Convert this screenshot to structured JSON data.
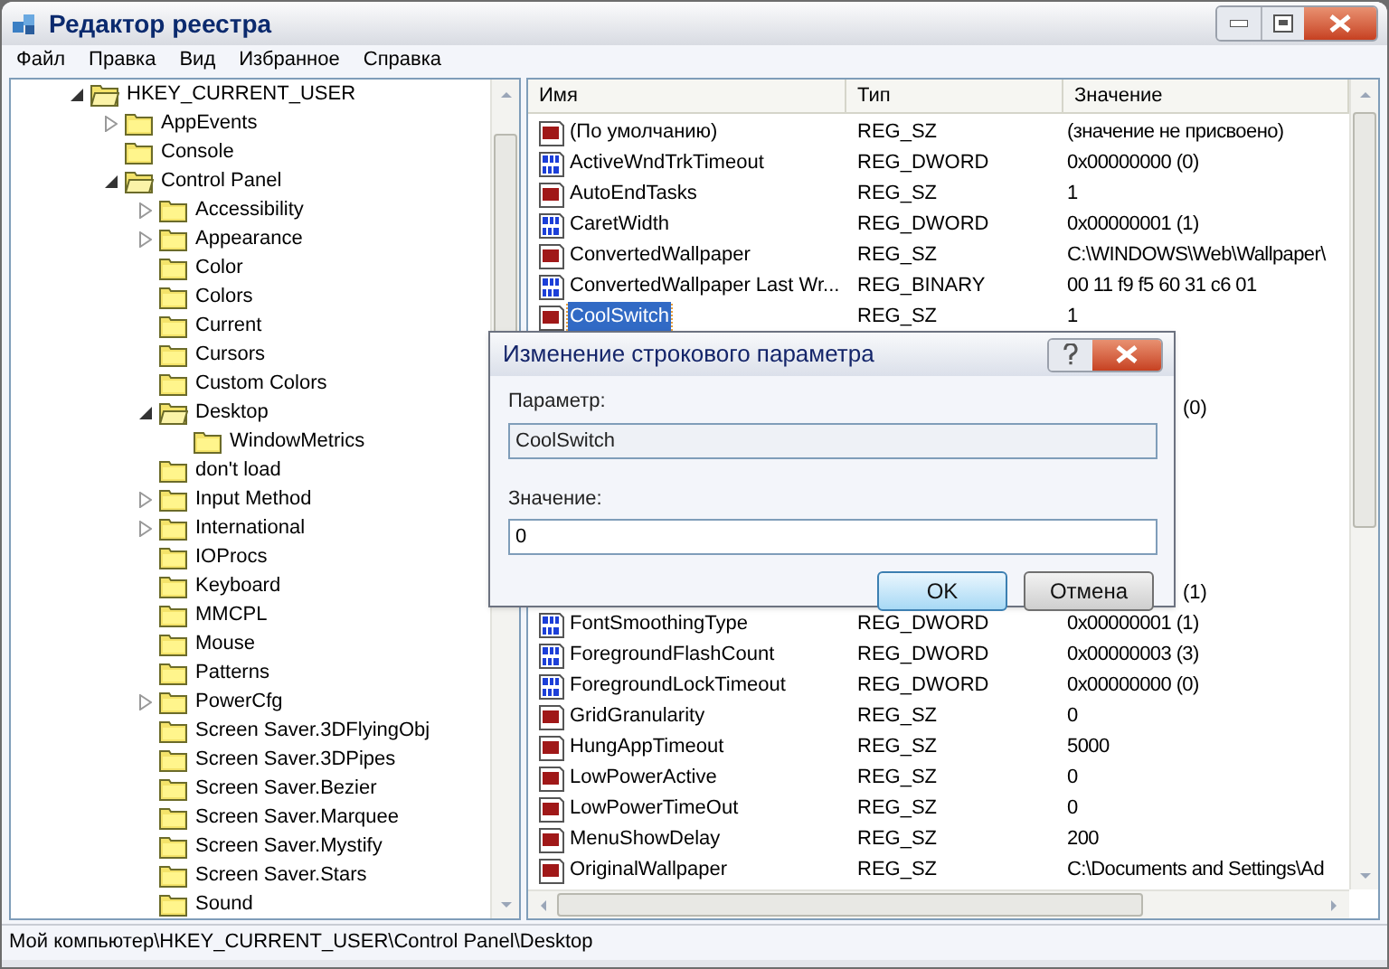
{
  "window": {
    "title": "Редактор реестра"
  },
  "menu": [
    "Файл",
    "Правка",
    "Вид",
    "Избранное",
    "Справка"
  ],
  "tree": [
    {
      "label": "HKEY_CURRENT_USER",
      "expanded": true,
      "children": [
        {
          "label": "AppEvents",
          "expanded": false
        },
        {
          "label": "Console"
        },
        {
          "label": "Control Panel",
          "expanded": true,
          "children": [
            {
              "label": "Accessibility",
              "expanded": false
            },
            {
              "label": "Appearance",
              "expanded": false
            },
            {
              "label": "Color"
            },
            {
              "label": "Colors"
            },
            {
              "label": "Current"
            },
            {
              "label": "Cursors"
            },
            {
              "label": "Custom Colors"
            },
            {
              "label": "Desktop",
              "expanded": true,
              "children": [
                {
                  "label": "WindowMetrics"
                }
              ]
            },
            {
              "label": "don't load"
            },
            {
              "label": "Input Method",
              "expanded": false
            },
            {
              "label": "International",
              "expanded": false
            },
            {
              "label": "IOProcs"
            },
            {
              "label": "Keyboard"
            },
            {
              "label": "MMCPL"
            },
            {
              "label": "Mouse"
            },
            {
              "label": "Patterns"
            },
            {
              "label": "PowerCfg",
              "expanded": false
            },
            {
              "label": "Screen Saver.3DFlyingObj"
            },
            {
              "label": "Screen Saver.3DPipes"
            },
            {
              "label": "Screen Saver.Bezier"
            },
            {
              "label": "Screen Saver.Marquee"
            },
            {
              "label": "Screen Saver.Mystify"
            },
            {
              "label": "Screen Saver.Stars"
            },
            {
              "label": "Sound"
            }
          ]
        }
      ]
    }
  ],
  "list": {
    "columns": [
      "Имя",
      "Тип",
      "Значение"
    ],
    "rows": [
      {
        "kind": "string",
        "name": "(По умолчанию)",
        "type": "REG_SZ",
        "value": "(значение не присвоено)",
        "selected": false
      },
      {
        "kind": "binary",
        "name": "ActiveWndTrkTimeout",
        "type": "REG_DWORD",
        "value": "0x00000000 (0)",
        "selected": false
      },
      {
        "kind": "string",
        "name": "AutoEndTasks",
        "type": "REG_SZ",
        "value": "1",
        "selected": false
      },
      {
        "kind": "binary",
        "name": "CaretWidth",
        "type": "REG_DWORD",
        "value": "0x00000001 (1)",
        "selected": false
      },
      {
        "kind": "string",
        "name": "ConvertedWallpaper",
        "type": "REG_SZ",
        "value": "C:\\WINDOWS\\Web\\Wallpaper\\",
        "selected": false
      },
      {
        "kind": "binary",
        "name": "ConvertedWallpaper Last Wr...",
        "type": "REG_BINARY",
        "value": "00 11 f9 f5 60 31 c6 01",
        "selected": false
      },
      {
        "kind": "string",
        "name": "CoolSwitch",
        "type": "REG_SZ",
        "value": "1",
        "selected": true
      },
      {
        "kind": "covered"
      },
      {
        "kind": "covered"
      },
      {
        "kind": "covered",
        "value": "(0)"
      },
      {
        "kind": "covered"
      },
      {
        "kind": "covered"
      },
      {
        "kind": "covered"
      },
      {
        "kind": "covered"
      },
      {
        "kind": "covered"
      },
      {
        "kind": "covered",
        "value": "(1)"
      },
      {
        "kind": "binary",
        "name": "FontSmoothingType",
        "type": "REG_DWORD",
        "value": "0x00000001 (1)",
        "selected": false
      },
      {
        "kind": "binary",
        "name": "ForegroundFlashCount",
        "type": "REG_DWORD",
        "value": "0x00000003 (3)",
        "selected": false
      },
      {
        "kind": "binary",
        "name": "ForegroundLockTimeout",
        "type": "REG_DWORD",
        "value": "0x00000000 (0)",
        "selected": false
      },
      {
        "kind": "string",
        "name": "GridGranularity",
        "type": "REG_SZ",
        "value": "0",
        "selected": false
      },
      {
        "kind": "string",
        "name": "HungAppTimeout",
        "type": "REG_SZ",
        "value": "5000",
        "selected": false
      },
      {
        "kind": "string",
        "name": "LowPowerActive",
        "type": "REG_SZ",
        "value": "0",
        "selected": false
      },
      {
        "kind": "string",
        "name": "LowPowerTimeOut",
        "type": "REG_SZ",
        "value": "0",
        "selected": false
      },
      {
        "kind": "string",
        "name": "MenuShowDelay",
        "type": "REG_SZ",
        "value": "200",
        "selected": false
      },
      {
        "kind": "string",
        "name": "OriginalWallpaper",
        "type": "REG_SZ",
        "value": "C:\\Documents and Settings\\Ad",
        "selected": false
      }
    ]
  },
  "status_bar": "Мой компьютер\\HKEY_CURRENT_USER\\Control Panel\\Desktop",
  "dialog": {
    "title": "Изменение строкового параметра",
    "parameter_label": "Параметр:",
    "parameter_value": "CoolSwitch",
    "value_label": "Значение:",
    "value": "0",
    "buttons": [
      {
        "label": "OK",
        "selected": true
      },
      {
        "label": "Отмена",
        "selected": false
      }
    ]
  }
}
